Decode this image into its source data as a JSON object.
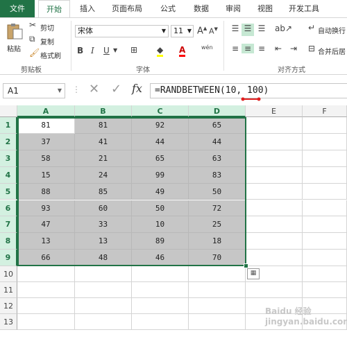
{
  "tabs": [
    "文件",
    "开始",
    "插入",
    "页面布局",
    "公式",
    "数据",
    "审阅",
    "视图",
    "开发工具"
  ],
  "ribbon": {
    "clipboard": {
      "paste": "粘贴",
      "cut": "剪切",
      "copy": "复制",
      "format_painter": "格式刷",
      "label": "剪贴板"
    },
    "font": {
      "name": "宋体",
      "size": "11",
      "label": "字体",
      "grow": "A",
      "shrink": "A",
      "bold": "B",
      "italic": "I",
      "underline": "U",
      "font_color_letter": "A",
      "phonetic": "wén"
    },
    "align": {
      "wrap": "自动换行",
      "merge": "合并后居",
      "label": "对齐方式"
    }
  },
  "formula_bar": {
    "name_box": "A1",
    "fx": "fx",
    "formula": "=RANDBETWEEN(10, 100)"
  },
  "columns": [
    "A",
    "B",
    "C",
    "D",
    "E",
    "F"
  ],
  "rows": [
    "1",
    "2",
    "3",
    "4",
    "5",
    "6",
    "7",
    "8",
    "9",
    "10",
    "11",
    "12",
    "13"
  ],
  "cells": [
    [
      "81",
      "81",
      "92",
      "65"
    ],
    [
      "37",
      "41",
      "44",
      "44"
    ],
    [
      "58",
      "21",
      "65",
      "63"
    ],
    [
      "15",
      "24",
      "99",
      "83"
    ],
    [
      "88",
      "85",
      "49",
      "50"
    ],
    [
      "93",
      "60",
      "50",
      "72"
    ],
    [
      "47",
      "33",
      "10",
      "25"
    ],
    [
      "13",
      "13",
      "89",
      "18"
    ],
    [
      "66",
      "48",
      "46",
      "70"
    ]
  ],
  "colors": {
    "accent": "#217346",
    "selection_fill": "#c6c6c6",
    "header_selected": "#d3f0e0",
    "annotation": "#e02020"
  },
  "watermark": "Baidu 经验 jingyan.baidu.com"
}
